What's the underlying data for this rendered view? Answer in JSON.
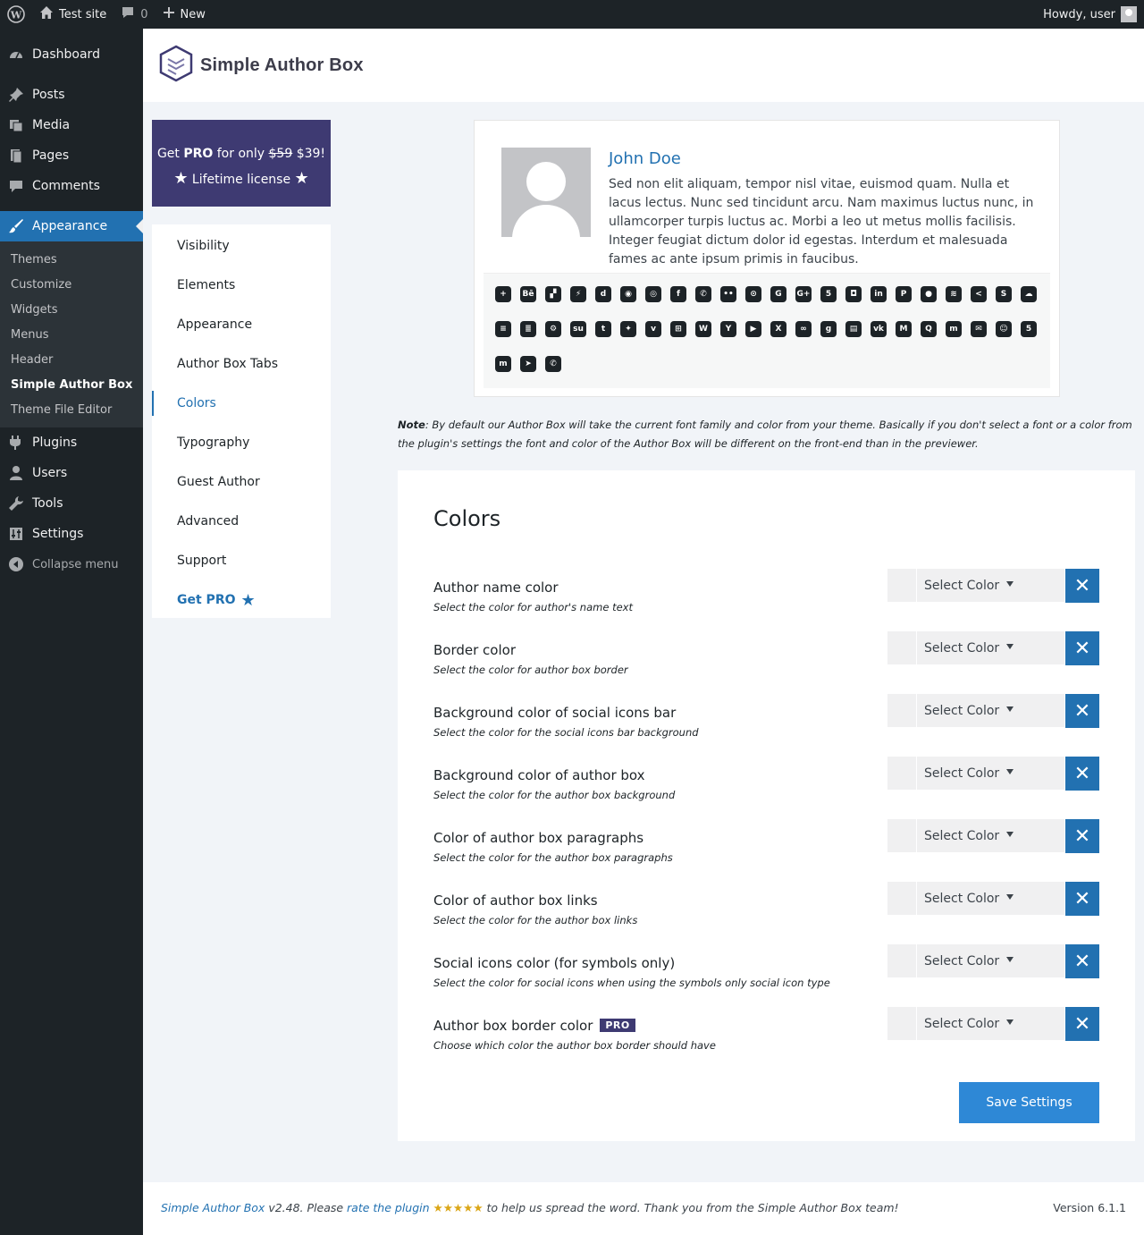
{
  "adminbar": {
    "site_name": "Test site",
    "comments_count": "0",
    "new_label": "New",
    "howdy": "Howdy, user"
  },
  "sidebar": {
    "items": [
      {
        "label": "Dashboard",
        "icon": "dashboard-icon"
      },
      {
        "label": "Posts",
        "icon": "pin-icon"
      },
      {
        "label": "Media",
        "icon": "media-icon"
      },
      {
        "label": "Pages",
        "icon": "pages-icon"
      },
      {
        "label": "Comments",
        "icon": "comments-icon"
      },
      {
        "label": "Appearance",
        "icon": "brush-icon"
      },
      {
        "label": "Plugins",
        "icon": "plugin-icon"
      },
      {
        "label": "Users",
        "icon": "users-icon"
      },
      {
        "label": "Tools",
        "icon": "wrench-icon"
      },
      {
        "label": "Settings",
        "icon": "settings-icon"
      },
      {
        "label": "Collapse menu",
        "icon": "collapse-icon"
      }
    ],
    "submenu": [
      "Themes",
      "Customize",
      "Widgets",
      "Menus",
      "Header",
      "Simple Author Box",
      "Theme File Editor"
    ]
  },
  "brand": "Simple Author Box",
  "promo": {
    "prefix": "Get ",
    "pro": "PRO",
    "for_only": " for only ",
    "old_price": "$59",
    "new_price": " $39!",
    "license": "Lifetime license"
  },
  "tabs": [
    "Visibility",
    "Elements",
    "Appearance",
    "Author Box Tabs",
    "Colors",
    "Typography",
    "Guest Author",
    "Advanced",
    "Support"
  ],
  "get_pro": "Get PRO",
  "preview": {
    "author_name": "John Doe",
    "description": "Sed non elit aliquam, tempor nisl vitae, euismod quam. Nulla et lacus lectus. Nunc sed tincidunt arcu. Nam maximus luctus nunc, in ullamcorper turpis luctus ac. Morbi a leo ut metus mollis facilisis. Integer feugiat dictum dolor id egestas. Interdum et malesuada fames ac ante ipsum primis in faucibus.",
    "social_icons": [
      {
        "name": "addthis-icon",
        "glyph": "+"
      },
      {
        "name": "behance-icon",
        "glyph": "Bē"
      },
      {
        "name": "delicious-icon",
        "glyph": "▞"
      },
      {
        "name": "deviantart-icon",
        "glyph": "⚡"
      },
      {
        "name": "digg-icon",
        "glyph": "d"
      },
      {
        "name": "discord-icon",
        "glyph": "◉"
      },
      {
        "name": "dribbble-icon",
        "glyph": "◎"
      },
      {
        "name": "facebook-icon",
        "glyph": "f"
      },
      {
        "name": "whatsapp-icon",
        "glyph": "✆"
      },
      {
        "name": "flickr-icon",
        "glyph": "••"
      },
      {
        "name": "github-icon",
        "glyph": "⊙"
      },
      {
        "name": "google-icon",
        "glyph": "G"
      },
      {
        "name": "googleplus-icon",
        "glyph": "G+"
      },
      {
        "name": "html5-icon",
        "glyph": "5"
      },
      {
        "name": "instagram-icon",
        "glyph": "◘"
      },
      {
        "name": "linkedin-icon",
        "glyph": "in"
      },
      {
        "name": "pinterest-icon",
        "glyph": "P"
      },
      {
        "name": "reddit-icon",
        "glyph": "●"
      },
      {
        "name": "rss-icon",
        "glyph": "≋"
      },
      {
        "name": "share-icon",
        "glyph": "<"
      },
      {
        "name": "skype-icon",
        "glyph": "S"
      },
      {
        "name": "soundcloud-icon",
        "glyph": "☁"
      },
      {
        "name": "spotify-icon",
        "glyph": "≡"
      },
      {
        "name": "stackoverflow-icon",
        "glyph": "≣"
      },
      {
        "name": "steam-icon",
        "glyph": "⚙"
      },
      {
        "name": "stumbleupon-icon",
        "glyph": "su"
      },
      {
        "name": "tumblr-icon",
        "glyph": "t"
      },
      {
        "name": "twitter-icon",
        "glyph": "✦"
      },
      {
        "name": "vimeo-icon",
        "glyph": "v"
      },
      {
        "name": "windows-icon",
        "glyph": "⊞"
      },
      {
        "name": "wordpress-icon",
        "glyph": "W"
      },
      {
        "name": "ycombinator-icon",
        "glyph": "Y"
      },
      {
        "name": "youtube-icon",
        "glyph": "▶"
      },
      {
        "name": "xing-icon",
        "glyph": "X"
      },
      {
        "name": "mixcloud-icon",
        "glyph": "∞"
      },
      {
        "name": "goodreads-icon",
        "glyph": "g"
      },
      {
        "name": "twitch-icon",
        "glyph": "▤"
      },
      {
        "name": "vk-icon",
        "glyph": "vk"
      },
      {
        "name": "medium-icon",
        "glyph": "M"
      },
      {
        "name": "quora-icon",
        "glyph": "Q"
      },
      {
        "name": "meetup-icon",
        "glyph": "m"
      },
      {
        "name": "email-icon",
        "glyph": "✉"
      },
      {
        "name": "snapchat-icon",
        "glyph": "☺"
      },
      {
        "name": "500px-icon",
        "glyph": "5"
      },
      {
        "name": "mastodon-icon",
        "glyph": "m"
      },
      {
        "name": "telegram-icon",
        "glyph": "➤"
      },
      {
        "name": "phone-icon",
        "glyph": "✆"
      }
    ]
  },
  "note": {
    "bold": "Note",
    "text": ": By default our Author Box will take the current font family and color from your theme. Basically if you don't select a font or a color from the plugin's settings the font and color of the Author Box will be different on the front-end than in the previewer."
  },
  "colors": {
    "title": "Colors",
    "select_label": "Select Color",
    "pro_badge": "PRO",
    "rows": [
      {
        "label": "Author name color",
        "desc": "Select the color for author's name text",
        "pro": false
      },
      {
        "label": "Border color",
        "desc": "Select the color for author box border",
        "pro": false
      },
      {
        "label": "Background color of social icons bar",
        "desc": "Select the color for the social icons bar background",
        "pro": false
      },
      {
        "label": "Background color of author box",
        "desc": "Select the color for the author box background",
        "pro": false
      },
      {
        "label": "Color of author box paragraphs",
        "desc": "Select the color for the author box paragraphs",
        "pro": false
      },
      {
        "label": "Color of author box links",
        "desc": "Select the color for the author box links",
        "pro": false
      },
      {
        "label": "Social icons color (for symbols only)",
        "desc": "Select the color for social icons when using the symbols only social icon type",
        "pro": false
      },
      {
        "label": "Author box border color",
        "desc": "Choose which color the author box border should have",
        "pro": true
      }
    ],
    "save_label": "Save Settings"
  },
  "footer": {
    "plugin": "Simple Author Box",
    "version_text": " v2.48. Please ",
    "rate": "rate the plugin",
    "stars": " ★★★★★ ",
    "thanks": "to help us spread the word. Thank you from the Simple Author Box team!",
    "wp_version": "Version 6.1.1"
  },
  "theme_colors": {
    "admin_dark": "#1d2327",
    "accent": "#2271b1",
    "pro_purple": "#3e3a72"
  }
}
